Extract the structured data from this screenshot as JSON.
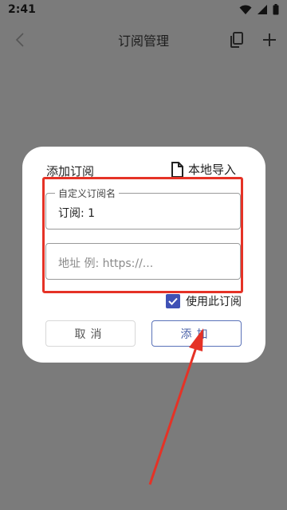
{
  "status_bar": {
    "time": "2:41",
    "icons": [
      "wifi-icon",
      "signal-icon",
      "battery-icon"
    ]
  },
  "app_bar": {
    "title": "订阅管理",
    "icons": [
      "back-icon",
      "copy-icon",
      "plus-icon"
    ]
  },
  "dialog": {
    "title": "添加订阅",
    "import_label": "本地导入",
    "name_field": {
      "label": "自定义订阅名",
      "value": "订阅: 1"
    },
    "url_field": {
      "placeholder": "地址 例: https://..."
    },
    "checkbox": {
      "label": "使用此订阅",
      "checked": true
    },
    "cancel_label": "取消",
    "add_label": "添加"
  },
  "colors": {
    "accent": "#3f51b5",
    "annotation": "#e53226",
    "scrim": "#7b7b7b"
  }
}
